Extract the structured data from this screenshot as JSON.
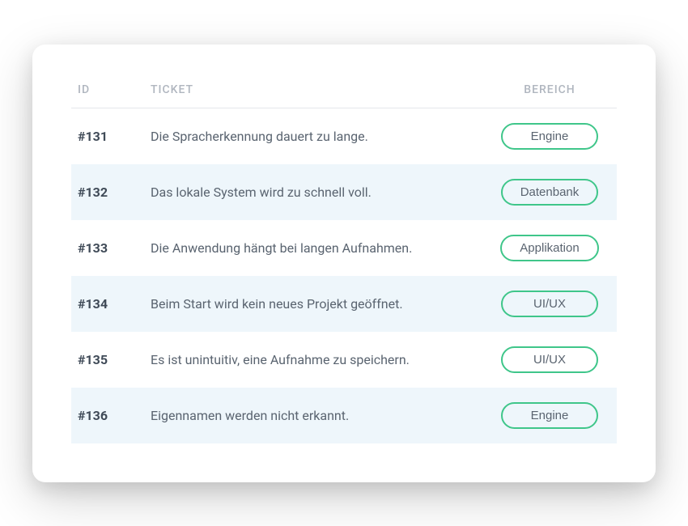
{
  "table": {
    "headers": {
      "id": "ID",
      "ticket": "TICKET",
      "bereich": "BEREICH"
    },
    "rows": [
      {
        "id": "#131",
        "ticket": "Die Spracherkennung dauert zu lange.",
        "bereich": "Engine"
      },
      {
        "id": "#132",
        "ticket": "Das lokale System wird zu schnell voll.",
        "bereich": "Datenbank"
      },
      {
        "id": "#133",
        "ticket": "Die Anwendung hängt bei langen Aufnahmen.",
        "bereich": "Applikation"
      },
      {
        "id": "#134",
        "ticket": "Beim Start wird kein neues Projekt geöffnet.",
        "bereich": "UI/UX"
      },
      {
        "id": "#135",
        "ticket": "Es ist unintuitiv, eine Aufnahme zu speichern.",
        "bereich": "UI/UX"
      },
      {
        "id": "#136",
        "ticket": "Eigennamen werden nicht erkannt.",
        "bereich": "Engine"
      }
    ]
  },
  "colors": {
    "pillBorder": "#3fc68a",
    "altRow": "#eef6fb"
  }
}
